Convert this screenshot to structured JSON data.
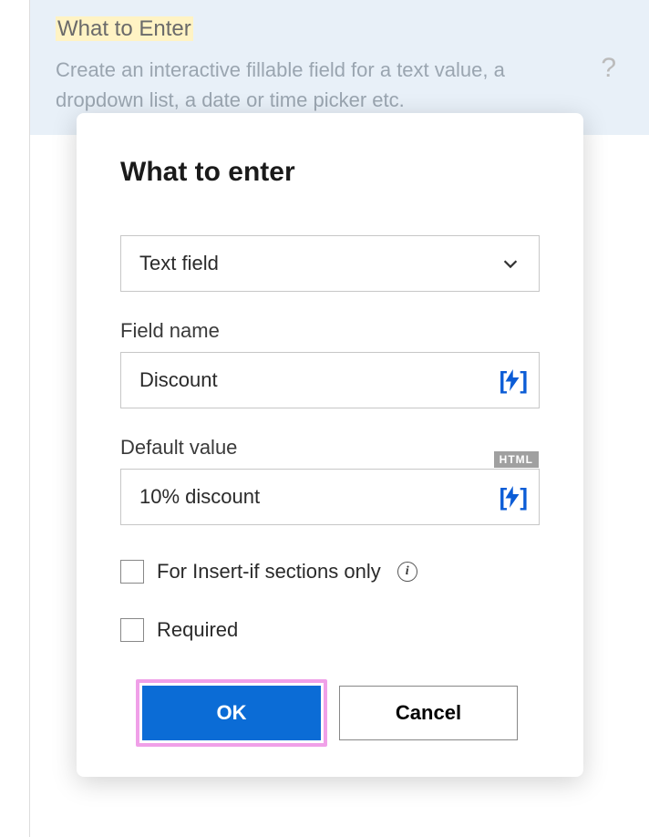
{
  "background": {
    "title": "What to Enter",
    "description": "Create an interactive fillable field for a text value, a dropdown list, a date or time picker etc."
  },
  "dialog": {
    "title": "What to enter",
    "fieldType": {
      "selected": "Text field"
    },
    "fieldName": {
      "label": "Field name",
      "value": "Discount"
    },
    "defaultValue": {
      "label": "Default value",
      "value": "10% discount",
      "badge": "HTML"
    },
    "checkboxes": {
      "insertIf": "For Insert-if sections only",
      "required": "Required"
    },
    "buttons": {
      "ok": "OK",
      "cancel": "Cancel"
    }
  }
}
